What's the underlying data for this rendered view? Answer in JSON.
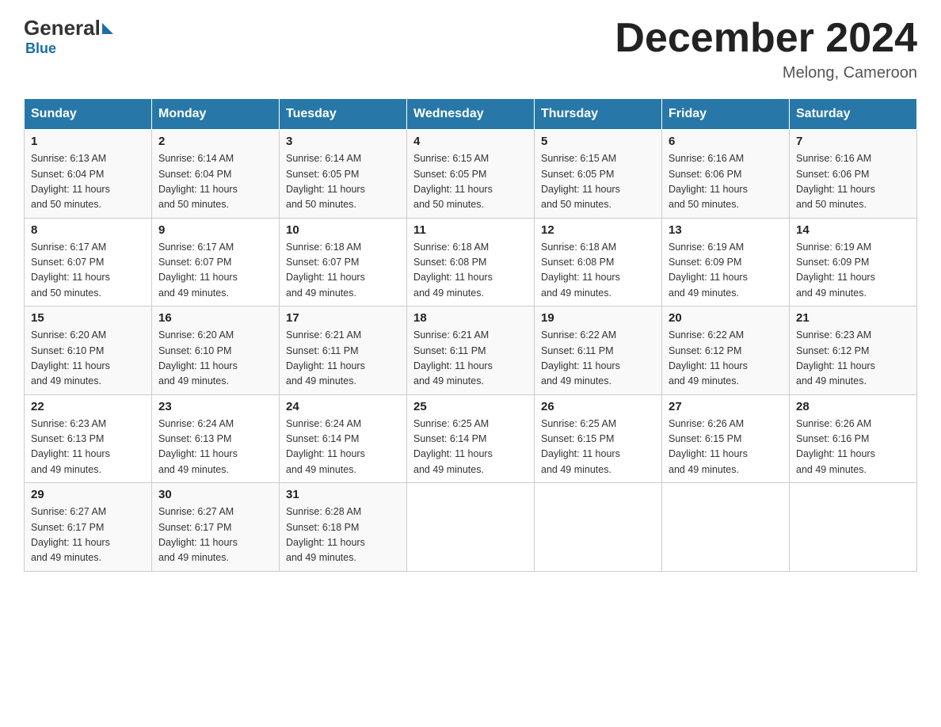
{
  "header": {
    "logo_general": "General",
    "logo_blue": "Blue",
    "month_title": "December 2024",
    "location": "Melong, Cameroon"
  },
  "days_of_week": [
    "Sunday",
    "Monday",
    "Tuesday",
    "Wednesday",
    "Thursday",
    "Friday",
    "Saturday"
  ],
  "weeks": [
    [
      {
        "day": 1,
        "sunrise": "6:13 AM",
        "sunset": "6:04 PM",
        "daylight": "11 hours and 50 minutes."
      },
      {
        "day": 2,
        "sunrise": "6:14 AM",
        "sunset": "6:04 PM",
        "daylight": "11 hours and 50 minutes."
      },
      {
        "day": 3,
        "sunrise": "6:14 AM",
        "sunset": "6:05 PM",
        "daylight": "11 hours and 50 minutes."
      },
      {
        "day": 4,
        "sunrise": "6:15 AM",
        "sunset": "6:05 PM",
        "daylight": "11 hours and 50 minutes."
      },
      {
        "day": 5,
        "sunrise": "6:15 AM",
        "sunset": "6:05 PM",
        "daylight": "11 hours and 50 minutes."
      },
      {
        "day": 6,
        "sunrise": "6:16 AM",
        "sunset": "6:06 PM",
        "daylight": "11 hours and 50 minutes."
      },
      {
        "day": 7,
        "sunrise": "6:16 AM",
        "sunset": "6:06 PM",
        "daylight": "11 hours and 50 minutes."
      }
    ],
    [
      {
        "day": 8,
        "sunrise": "6:17 AM",
        "sunset": "6:07 PM",
        "daylight": "11 hours and 50 minutes."
      },
      {
        "day": 9,
        "sunrise": "6:17 AM",
        "sunset": "6:07 PM",
        "daylight": "11 hours and 49 minutes."
      },
      {
        "day": 10,
        "sunrise": "6:18 AM",
        "sunset": "6:07 PM",
        "daylight": "11 hours and 49 minutes."
      },
      {
        "day": 11,
        "sunrise": "6:18 AM",
        "sunset": "6:08 PM",
        "daylight": "11 hours and 49 minutes."
      },
      {
        "day": 12,
        "sunrise": "6:18 AM",
        "sunset": "6:08 PM",
        "daylight": "11 hours and 49 minutes."
      },
      {
        "day": 13,
        "sunrise": "6:19 AM",
        "sunset": "6:09 PM",
        "daylight": "11 hours and 49 minutes."
      },
      {
        "day": 14,
        "sunrise": "6:19 AM",
        "sunset": "6:09 PM",
        "daylight": "11 hours and 49 minutes."
      }
    ],
    [
      {
        "day": 15,
        "sunrise": "6:20 AM",
        "sunset": "6:10 PM",
        "daylight": "11 hours and 49 minutes."
      },
      {
        "day": 16,
        "sunrise": "6:20 AM",
        "sunset": "6:10 PM",
        "daylight": "11 hours and 49 minutes."
      },
      {
        "day": 17,
        "sunrise": "6:21 AM",
        "sunset": "6:11 PM",
        "daylight": "11 hours and 49 minutes."
      },
      {
        "day": 18,
        "sunrise": "6:21 AM",
        "sunset": "6:11 PM",
        "daylight": "11 hours and 49 minutes."
      },
      {
        "day": 19,
        "sunrise": "6:22 AM",
        "sunset": "6:11 PM",
        "daylight": "11 hours and 49 minutes."
      },
      {
        "day": 20,
        "sunrise": "6:22 AM",
        "sunset": "6:12 PM",
        "daylight": "11 hours and 49 minutes."
      },
      {
        "day": 21,
        "sunrise": "6:23 AM",
        "sunset": "6:12 PM",
        "daylight": "11 hours and 49 minutes."
      }
    ],
    [
      {
        "day": 22,
        "sunrise": "6:23 AM",
        "sunset": "6:13 PM",
        "daylight": "11 hours and 49 minutes."
      },
      {
        "day": 23,
        "sunrise": "6:24 AM",
        "sunset": "6:13 PM",
        "daylight": "11 hours and 49 minutes."
      },
      {
        "day": 24,
        "sunrise": "6:24 AM",
        "sunset": "6:14 PM",
        "daylight": "11 hours and 49 minutes."
      },
      {
        "day": 25,
        "sunrise": "6:25 AM",
        "sunset": "6:14 PM",
        "daylight": "11 hours and 49 minutes."
      },
      {
        "day": 26,
        "sunrise": "6:25 AM",
        "sunset": "6:15 PM",
        "daylight": "11 hours and 49 minutes."
      },
      {
        "day": 27,
        "sunrise": "6:26 AM",
        "sunset": "6:15 PM",
        "daylight": "11 hours and 49 minutes."
      },
      {
        "day": 28,
        "sunrise": "6:26 AM",
        "sunset": "6:16 PM",
        "daylight": "11 hours and 49 minutes."
      }
    ],
    [
      {
        "day": 29,
        "sunrise": "6:27 AM",
        "sunset": "6:17 PM",
        "daylight": "11 hours and 49 minutes."
      },
      {
        "day": 30,
        "sunrise": "6:27 AM",
        "sunset": "6:17 PM",
        "daylight": "11 hours and 49 minutes."
      },
      {
        "day": 31,
        "sunrise": "6:28 AM",
        "sunset": "6:18 PM",
        "daylight": "11 hours and 49 minutes."
      },
      null,
      null,
      null,
      null
    ]
  ],
  "labels": {
    "sunrise": "Sunrise:",
    "sunset": "Sunset:",
    "daylight": "Daylight:"
  }
}
